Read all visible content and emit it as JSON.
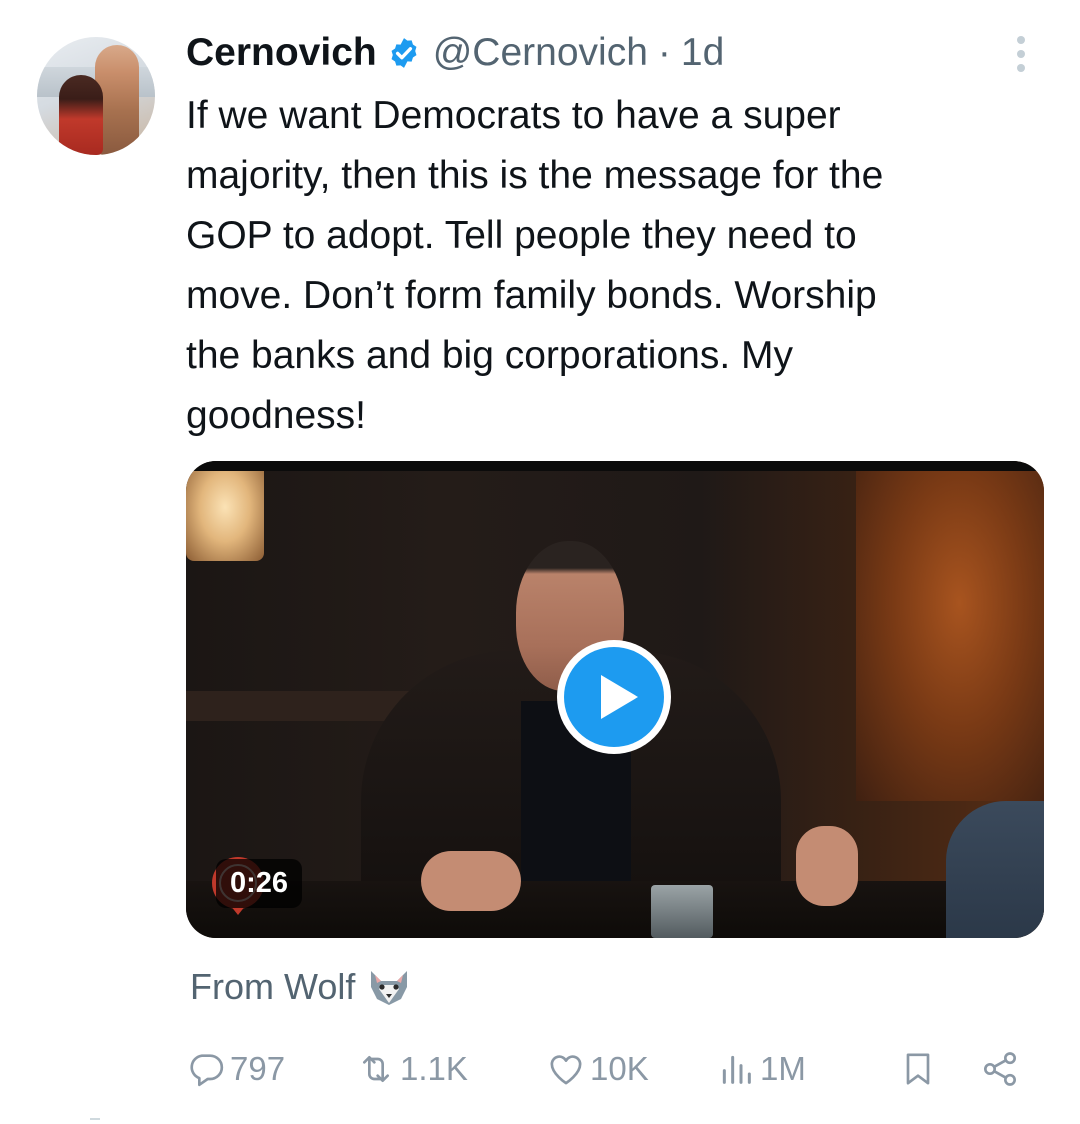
{
  "author": {
    "name": "Cernovich",
    "handle": "@Cernovich",
    "separator": "·",
    "time": "1d",
    "verified_icon": "verified-badge-icon"
  },
  "tweet": {
    "text": "If we want Democrats to have a super\nmajority, then this is the message for the\nGOP to adopt. Tell people they need to\nmove. Don’t form family bonds. Worship\nthe banks and big corporations. My\ngoodness!"
  },
  "video": {
    "duration": "0:26",
    "play_icon": "play-icon"
  },
  "caption": {
    "text": "From Wolf",
    "emoji_icon": "wolf-icon"
  },
  "actions": {
    "replies": "797",
    "retweets": "1.1K",
    "likes": "10K",
    "views": "1M"
  },
  "colors": {
    "accent": "#1d9bf0",
    "muted": "#536471",
    "action": "#8b98a5"
  }
}
